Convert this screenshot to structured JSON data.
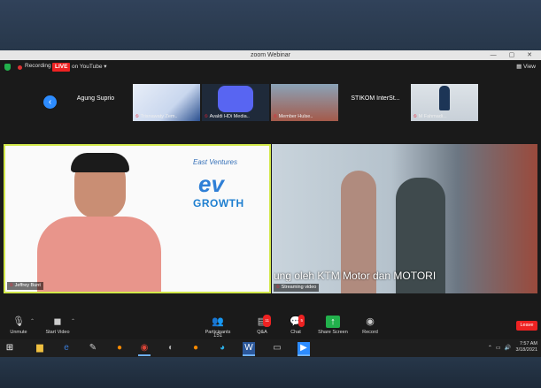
{
  "window": {
    "title": "zoom Webinar",
    "controls": "—  ▢  ✕"
  },
  "infobar": {
    "recording": "Recording",
    "live": "LIVE",
    "stream": "on YouTube ▾",
    "view": "▦ View"
  },
  "participants_strip": [
    {
      "name": "Agung Suprio",
      "type": "name-only"
    },
    {
      "name": "Trisnawaty Zem..",
      "type": "video"
    },
    {
      "name": "Avaldi HDi Media..",
      "type": "video"
    },
    {
      "name": "Member Hulse..",
      "type": "video"
    },
    {
      "name": "STIKOM InterSt...",
      "type": "name-only"
    },
    {
      "name": "M Fahmadi...",
      "type": "video"
    }
  ],
  "main_left": {
    "name": "Jeffrey Bunt",
    "brand": "East Ventures",
    "logo": "ev",
    "brand_tagline": "GROWTH"
  },
  "main_right": {
    "name": "Streaming video",
    "subtitle": "ung oleh KTM Motor dan MOTORI"
  },
  "toolbar": {
    "unmute": "Unmute",
    "start_video": "Start Video",
    "participants": "Participants",
    "participants_count": "151",
    "qa": "Q&A",
    "qa_badge": "11",
    "chat": "Chat",
    "chat_badge": "5",
    "share_screen": "Share Screen",
    "record": "Record",
    "end": "Leave"
  },
  "taskbar": {
    "time": "7:57 AM",
    "date": "3/18/2021",
    "apps": [
      "start-icon",
      "file-explorer-icon",
      "edge-icon",
      "sticky-icon",
      "firefox-icon",
      "chrome-icon",
      "firefox-icon-2",
      "edge-chromium-icon",
      "word-icon",
      "video-app-icon",
      "zoom-icon"
    ]
  },
  "colors": {
    "accent": "#2d8cff",
    "live": "#e22222",
    "speaker_border": "#d2e84a",
    "share": "#22b14c"
  }
}
